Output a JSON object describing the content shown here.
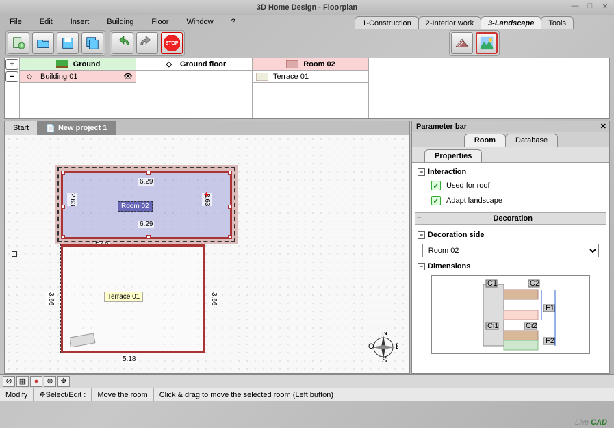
{
  "window": {
    "title": "3D Home Design - Floorplan"
  },
  "menu": {
    "file": "File",
    "edit": "Edit",
    "insert": "Insert",
    "building": "Building",
    "floor": "Floor",
    "window": "Window",
    "help": "?"
  },
  "top_tabs": {
    "t1": "1-Construction",
    "t2": "2-Interior work",
    "t3": "3-Landscape",
    "t4": "Tools"
  },
  "toolbar": {
    "stop": "STOP"
  },
  "hierarchy": {
    "col1_header": "Ground",
    "col1_row1": "Building 01",
    "col2_header": "Ground floor",
    "col3_header": "Room 02",
    "col3_row1": "Terrace 01"
  },
  "canvas_tabs": {
    "start": "Start",
    "project": "New project 1"
  },
  "floorplan": {
    "room02_label": "Room 02",
    "terrace_label": "Terrace 01",
    "dim_629": "6.29",
    "dim_263": "2.63",
    "dim_518": "5.18",
    "dim_366": "3.66",
    "compass_n": "N",
    "compass_s": "S",
    "compass_e": "E",
    "compass_w": "O"
  },
  "param": {
    "title": "Parameter bar",
    "tab_room": "Room",
    "tab_database": "Database",
    "tab_properties": "Properties",
    "sec_interaction": "Interaction",
    "chk_roof": "Used for roof",
    "chk_landscape": "Adapt landscape",
    "sec_decoration": "Decoration",
    "sec_deco_side": "Decoration side",
    "select_value": "Room 02",
    "sec_dimensions": "Dimensions",
    "diag_c1": "C1",
    "diag_c2": "C2",
    "diag_f1": "F1",
    "diag_f2": "F2",
    "diag_ci1": "Ci1",
    "diag_ci2": "Ci2"
  },
  "status": {
    "s1": "Modify",
    "s2": "Select/Edit :",
    "s3": "Move the room",
    "s4": "Click & drag to move the selected room (Left button)"
  },
  "logo": {
    "live": "Live",
    "cad": "CAD"
  }
}
